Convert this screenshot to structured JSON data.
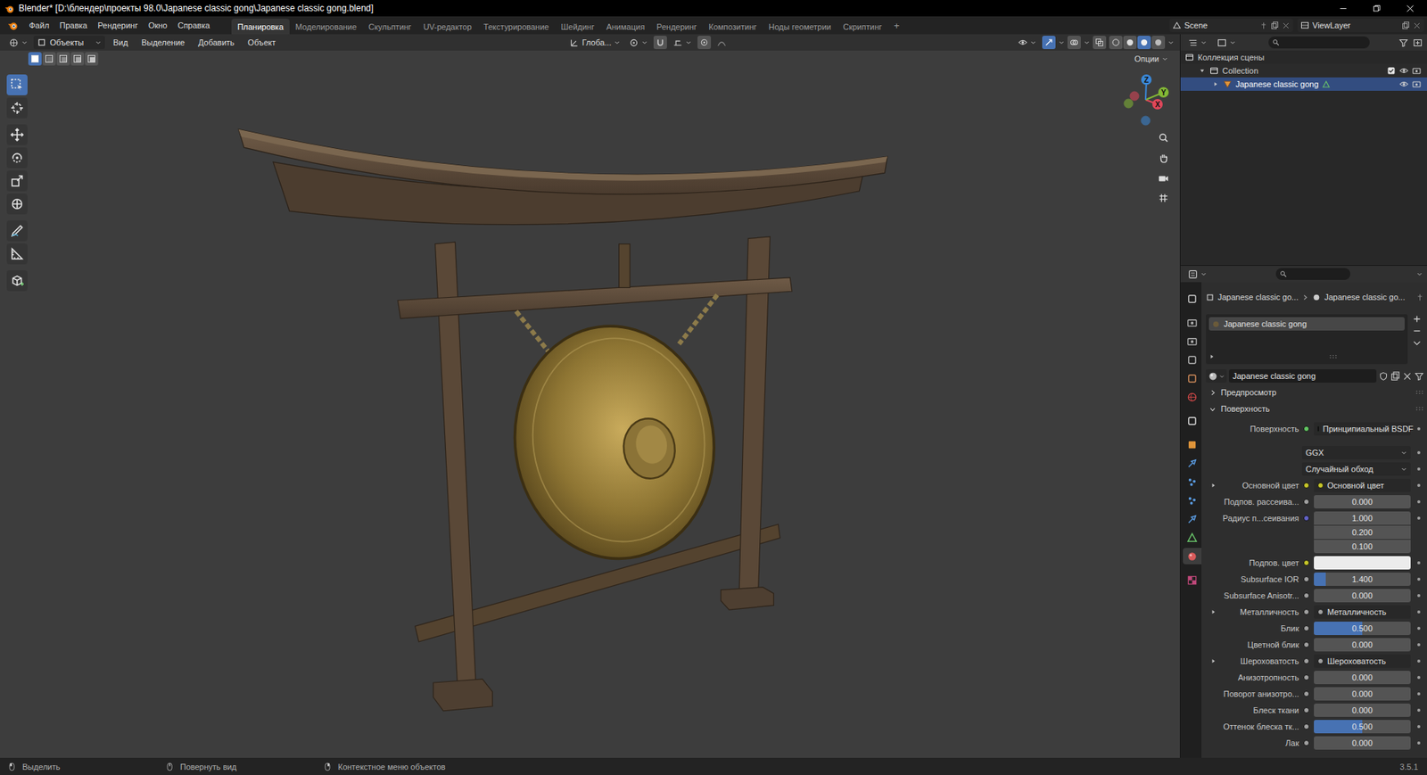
{
  "window": {
    "title": "Blender* [D:\\блендер\\проекты 98.0\\Japanese classic gong\\Japanese classic gong.blend]"
  },
  "menu": [
    "Файл",
    "Правка",
    "Рендеринг",
    "Окно",
    "Справка"
  ],
  "workspaces": [
    {
      "label": "Планировка",
      "selected": true
    },
    {
      "label": "Моделирование",
      "selected": false
    },
    {
      "label": "Скульптинг",
      "selected": false
    },
    {
      "label": "UV-редактор",
      "selected": false
    },
    {
      "label": "Текстурирование",
      "selected": false
    },
    {
      "label": "Шейдинг",
      "selected": false
    },
    {
      "label": "Анимация",
      "selected": false
    },
    {
      "label": "Рендеринг",
      "selected": false
    },
    {
      "label": "Композитинг",
      "selected": false
    },
    {
      "label": "Ноды геометрии",
      "selected": false
    },
    {
      "label": "Скриптинг",
      "selected": false
    }
  ],
  "add_workspace": "+",
  "scene": "Scene",
  "view_layer": "ViewLayer",
  "viewport": {
    "mode": "Объекты",
    "menus": [
      "Вид",
      "Выделение",
      "Добавить",
      "Объект"
    ],
    "orientation": "Глоба...",
    "options": "Опции",
    "select_modes": [
      {
        "selected": true
      },
      {
        "selected": false
      },
      {
        "selected": false
      },
      {
        "selected": false
      },
      {
        "selected": false
      }
    ],
    "shading_modes": [
      {
        "selected": false
      },
      {
        "selected": false
      },
      {
        "selected": true
      },
      {
        "selected": false
      }
    ],
    "tools": [
      {
        "kind": "select",
        "selected": true
      },
      {
        "kind": "cursor",
        "selected": false
      },
      {
        "kind": "move",
        "selected": false
      },
      {
        "kind": "rotate",
        "selected": false
      },
      {
        "kind": "scale",
        "selected": false
      },
      {
        "kind": "transform",
        "selected": false
      },
      {
        "kind": "annotate",
        "selected": false
      },
      {
        "kind": "measure",
        "selected": false
      },
      {
        "kind": "add-cube",
        "selected": false
      }
    ],
    "gizmo_axes": [
      {
        "label": "X",
        "color": "#e0475a"
      },
      {
        "label": "Y",
        "color": "#83b735"
      },
      {
        "label": "Z",
        "color": "#3a88d8"
      }
    ]
  },
  "outliner": {
    "items": [
      {
        "label": "Коллекция сцены",
        "depth": 0,
        "kind": "scene",
        "selected": false
      },
      {
        "label": "Collection",
        "depth": 1,
        "kind": "collection",
        "selected": false,
        "expanded": true,
        "checked": true
      },
      {
        "label": "Japanese classic gong",
        "depth": 2,
        "kind": "object",
        "selected": true,
        "expanded": false
      }
    ]
  },
  "properties": {
    "tabs": [
      {
        "kind": "tool",
        "color": "#c8c8c8",
        "selected": false
      },
      {
        "kind": "render",
        "color": "#b5b5b5",
        "selected": false
      },
      {
        "kind": "output",
        "color": "#b5b5b5",
        "selected": false
      },
      {
        "kind": "view-layer",
        "color": "#b5b5b5",
        "selected": false
      },
      {
        "kind": "scene",
        "color": "#d08b5a",
        "selected": false
      },
      {
        "kind": "world",
        "color": "#d04848",
        "selected": false
      },
      {
        "kind": "collection",
        "color": "#dcdcdc",
        "selected": false
      },
      {
        "kind": "object",
        "color": "#e0953a",
        "selected": false
      },
      {
        "kind": "modifiers",
        "color": "#5a9be0",
        "selected": false
      },
      {
        "kind": "particles",
        "color": "#5a9be0",
        "selected": false
      },
      {
        "kind": "physics",
        "color": "#5a9be0",
        "selected": false
      },
      {
        "kind": "constraints",
        "color": "#5a9be0",
        "selected": false
      },
      {
        "kind": "data",
        "color": "#68c269",
        "selected": false
      },
      {
        "kind": "material",
        "color": "#d95b5b",
        "selected": true
      },
      {
        "kind": "texture",
        "color": "#c0487a",
        "selected": false
      }
    ],
    "breadcrumb": [
      "Japanese classic go...",
      "Japanese classic go..."
    ],
    "slots": [
      {
        "label": "Japanese classic gong",
        "selected": true
      }
    ],
    "material": "Japanese classic gong",
    "sections": [
      {
        "label": "Предпросмотр",
        "expanded": false
      },
      {
        "label": "Поверхность",
        "expanded": true
      }
    ],
    "rows": [
      {
        "kind": "link",
        "label": "Поверхность",
        "value": "Принципиальный BSDF",
        "color": "#63c763"
      },
      {
        "kind": "dropdown",
        "value": "GGX"
      },
      {
        "kind": "dropdown",
        "value": "Случайный обход"
      },
      {
        "kind": "link",
        "label": "Основной цвет",
        "value": "Основной цвет",
        "color": "#c7c729",
        "expanded": false
      },
      {
        "kind": "number",
        "label": "Подпов. рассеива...",
        "value": "0.000",
        "level": 0,
        "color": "#a1a1a1"
      },
      {
        "kind": "vector",
        "label": "Радиус п...сеивания",
        "values": [
          "1.000",
          "0.200",
          "0.100"
        ],
        "color": "#6363c7"
      },
      {
        "kind": "color",
        "label": "Подпов. цвет",
        "swatch": "#ececec",
        "color": "#c7c729"
      },
      {
        "kind": "number",
        "label": "Subsurface IOR",
        "value": "1.400",
        "level": 0.12,
        "color": "#a1a1a1"
      },
      {
        "kind": "number",
        "label": "Subsurface Anisotr...",
        "value": "0.000",
        "level": 0,
        "color": "#a1a1a1"
      },
      {
        "kind": "link",
        "label": "Металличность",
        "value": "Металличность",
        "color": "#a1a1a1",
        "expanded": false
      },
      {
        "kind": "number",
        "label": "Блик",
        "value": "0.500",
        "level": 0.5,
        "color": "#a1a1a1"
      },
      {
        "kind": "number",
        "label": "Цветной блик",
        "value": "0.000",
        "level": 0,
        "color": "#a1a1a1"
      },
      {
        "kind": "link",
        "label": "Шероховатость",
        "value": "Шероховатость",
        "color": "#a1a1a1",
        "expanded": false
      },
      {
        "kind": "number",
        "label": "Анизотропность",
        "value": "0.000",
        "level": 0,
        "color": "#a1a1a1"
      },
      {
        "kind": "number",
        "label": "Поворот анизотро...",
        "value": "0.000",
        "level": 0,
        "color": "#a1a1a1"
      },
      {
        "kind": "number",
        "label": "Блеск ткани",
        "value": "0.000",
        "level": 0,
        "color": "#a1a1a1"
      },
      {
        "kind": "number",
        "label": "Оттенок блеска тк...",
        "value": "0.500",
        "level": 0.5,
        "color": "#a1a1a1"
      },
      {
        "kind": "number",
        "label": "Лак",
        "value": "0.000",
        "level": 0,
        "color": "#a1a1a1"
      }
    ]
  },
  "status_bar": {
    "items": [
      "Выделить",
      "Повернуть вид",
      "Контекстное меню объектов"
    ],
    "version": "3.5.1"
  }
}
